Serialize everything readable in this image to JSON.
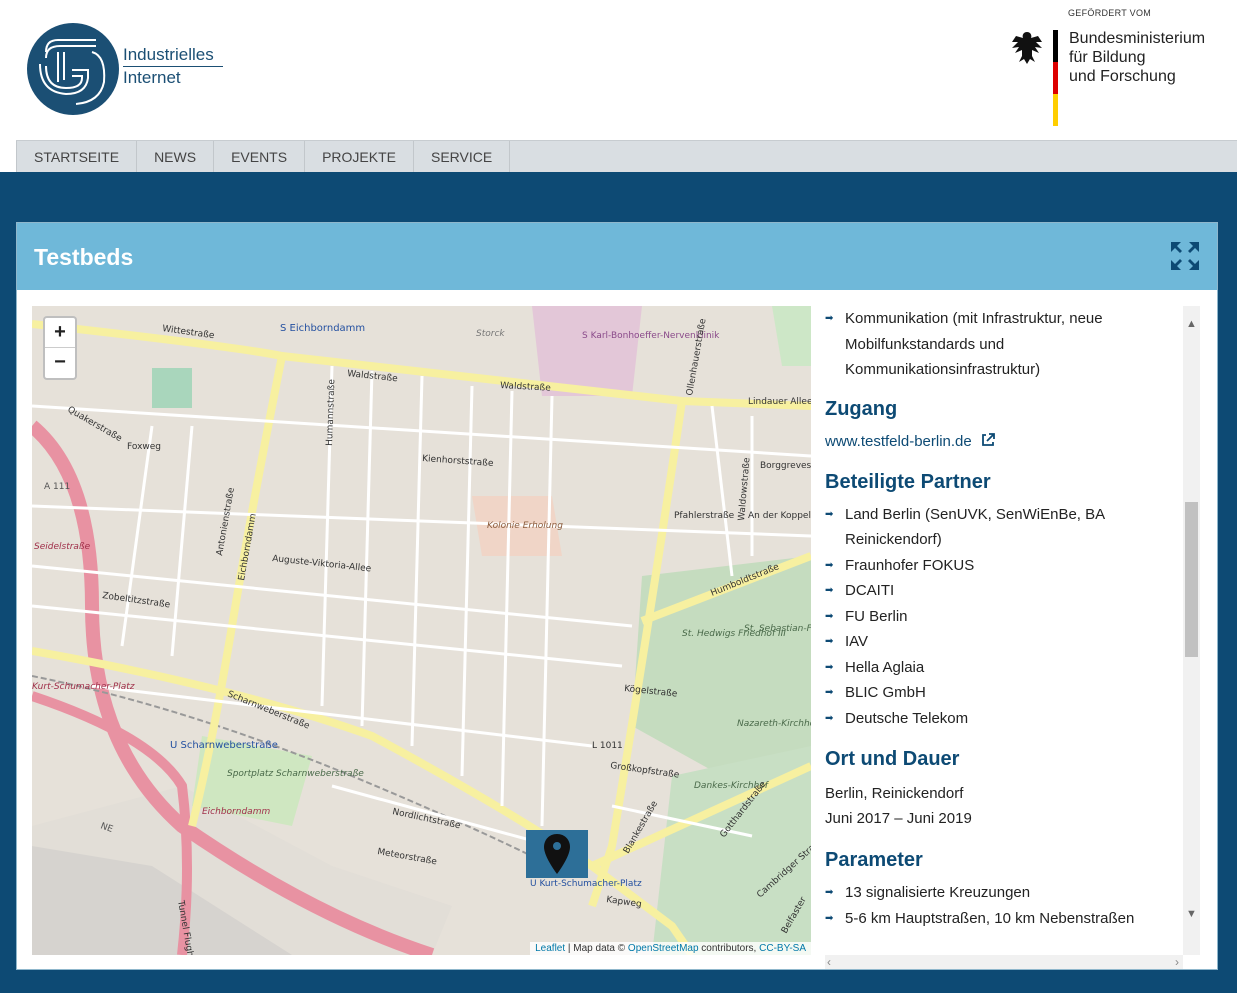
{
  "logo": {
    "line1": "Industrielles",
    "line2": "Internet"
  },
  "funding": {
    "label": "GEFÖRDERT VOM",
    "line1": "Bundesministerium",
    "line2": "für Bildung",
    "line3": "und Forschung"
  },
  "nav": {
    "items": [
      "STARTSEITE",
      "NEWS",
      "EVENTS",
      "PROJEKTE",
      "SERVICE"
    ]
  },
  "panel": {
    "title": "Testbeds"
  },
  "map": {
    "zoom_in": "+",
    "zoom_out": "−",
    "attribution": {
      "leaflet": "Leaflet",
      "sep": " | Map data © ",
      "osm": "OpenStreetMap",
      "contrib": " contributors, ",
      "license": "CC-BY-SA"
    },
    "labels": [
      "S Eichborndamm",
      "Wittestraße",
      "Waldstraße",
      "Waldstraße",
      "S Karl-Bonhoeffer-Nervenklinik",
      "Storck",
      "Lindauer Allee",
      "Kienhorststraße",
      "Humannstraße",
      "Ollenhauerstraße",
      "Antonienstraße",
      "Eichborndamm",
      "Auguste-Viktoria-Allee",
      "Kolonie Erholung",
      "Humboldtstraße",
      "St. Hedwigs Friedhof III",
      "St. Sebastian-Friedhof",
      "Nazareth-Kirchhof II",
      "Dankes-Kirchhof",
      "Scharnweberstraße",
      "U Scharnweberstraße",
      "Sportplatz Scharnweberstraße",
      "Eichborndamm",
      "A 111",
      "Seidelstraße",
      "Kurt-Schumacher-Platz",
      "L 1011",
      "Gotthardstraße",
      "Kapweg",
      "U Kurt-Schumacher-Platz",
      "Zobeltitzstraße",
      "Quakerstraße",
      "Foxweg",
      "Kögelstraße",
      "Großkopfstraße",
      "Nordlichtstraße",
      "Meteorstraße",
      "Pfahlerstraße",
      "Borggrevestraße",
      "An der Koppel",
      "Waldowstraße",
      "Blankestraße",
      "Cambridger Straße",
      "Belfaster",
      "Tunnel Flughafen",
      "NE"
    ]
  },
  "sidebar": {
    "intro_items": [
      "Kommunikation (mit Infrastruktur, neue",
      "Mobilfunkstandards und",
      "Kommunikationsinfrastruktur)"
    ],
    "access": {
      "heading": "Zugang",
      "link": "www.testfeld-berlin.de"
    },
    "partners": {
      "heading": "Beteiligte Partner",
      "items": [
        "Land Berlin (SenUVK, SenWiEnBe, BA Reinickendorf)",
        "Fraunhofer FOKUS",
        "DCAITI",
        "FU Berlin",
        "IAV",
        "Hella Aglaia",
        "BLIC GmbH",
        "Deutsche Telekom"
      ]
    },
    "location": {
      "heading": "Ort und Dauer",
      "place": "Berlin, Reinickendorf",
      "period": "Juni 2017 – Juni 2019"
    },
    "parameters": {
      "heading": "Parameter",
      "items": [
        "13 signalisierte Kreuzungen",
        "5-6 km Hauptstraßen, 10 km Nebenstraßen"
      ]
    }
  }
}
